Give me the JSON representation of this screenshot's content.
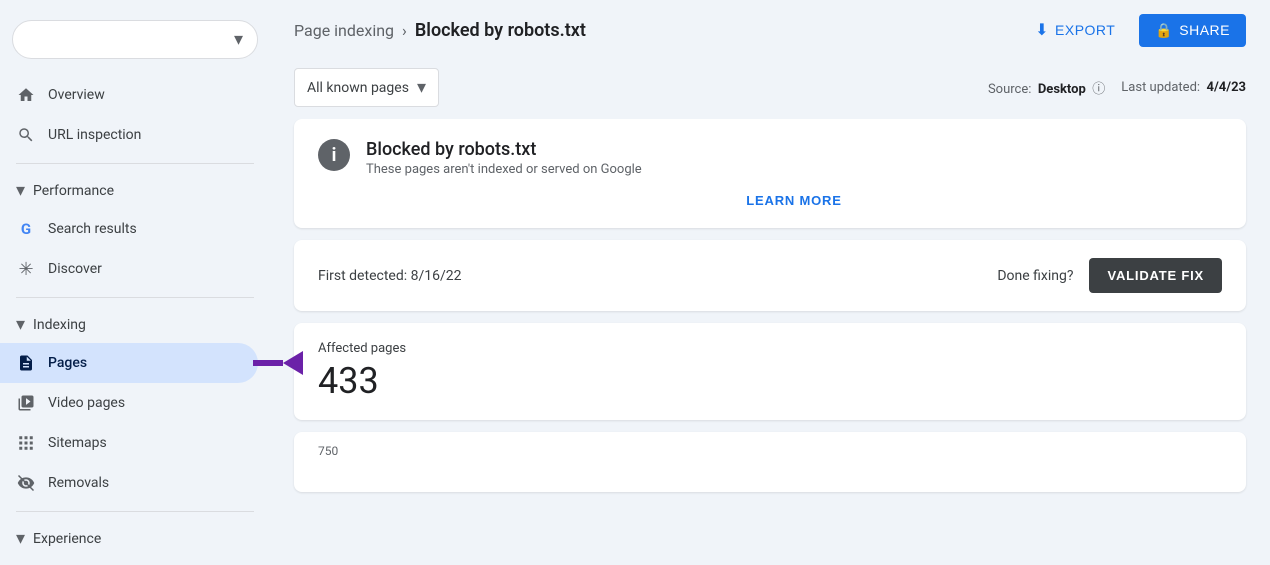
{
  "sidebar": {
    "dropdown_text": "",
    "items": [
      {
        "id": "overview",
        "label": "Overview",
        "icon": "🏠"
      },
      {
        "id": "url-inspection",
        "label": "URL inspection",
        "icon": "🔍"
      }
    ],
    "sections": [
      {
        "id": "performance",
        "label": "Performance",
        "expanded": true,
        "items": [
          {
            "id": "search-results",
            "label": "Search results",
            "icon": "G"
          },
          {
            "id": "discover",
            "label": "Discover",
            "icon": "✳"
          }
        ]
      },
      {
        "id": "indexing",
        "label": "Indexing",
        "expanded": true,
        "items": [
          {
            "id": "pages",
            "label": "Pages",
            "icon": "📄",
            "active": true
          },
          {
            "id": "video-pages",
            "label": "Video pages",
            "icon": "📹"
          },
          {
            "id": "sitemaps",
            "label": "Sitemaps",
            "icon": "🗺"
          },
          {
            "id": "removals",
            "label": "Removals",
            "icon": "👁"
          }
        ]
      },
      {
        "id": "experience",
        "label": "Experience",
        "expanded": false,
        "items": []
      }
    ]
  },
  "topbar": {
    "breadcrumb_parent": "Page indexing",
    "breadcrumb_separator": "›",
    "breadcrumb_current": "Blocked by robots.txt",
    "export_label": "EXPORT",
    "share_label": "SHARE"
  },
  "filter_bar": {
    "filter_label": "All known pages",
    "source_label": "Source:",
    "source_value": "Desktop",
    "last_updated_label": "Last updated:",
    "last_updated_value": "4/4/23"
  },
  "info_card": {
    "title": "Blocked by robots.txt",
    "subtitle": "These pages aren't indexed or served on Google",
    "learn_more": "LEARN MORE",
    "icon_text": "i"
  },
  "detection_card": {
    "first_detected_label": "First detected:",
    "first_detected_value": "8/16/22",
    "done_fixing_label": "Done fixing?",
    "validate_label": "VALIDATE FIX"
  },
  "affected_card": {
    "label": "Affected pages",
    "count": "433"
  },
  "chart_card": {
    "y_label": "750"
  }
}
